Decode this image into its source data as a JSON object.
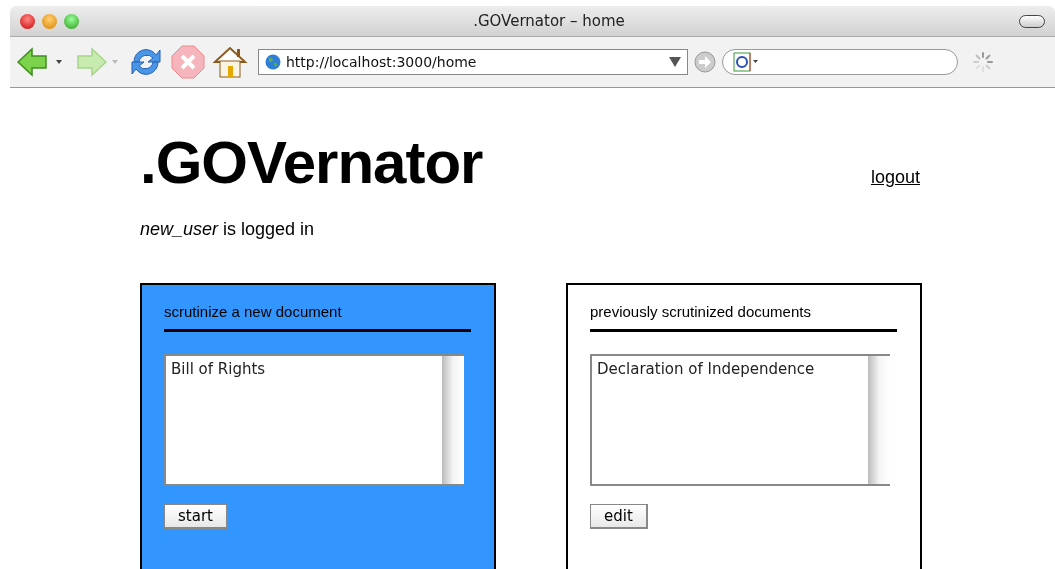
{
  "window": {
    "title": ".GOVernator – home"
  },
  "toolbar": {
    "url": "http://localhost:3000/home"
  },
  "page": {
    "heading": ".GOVernator",
    "logout": "logout",
    "status": "*new_user* is logged in"
  },
  "panels": [
    {
      "title": "scrutinize a new document",
      "color": "#3396ff",
      "items": [
        "Bill of Rights"
      ],
      "button": "start"
    },
    {
      "title": "previously scrutinized documents",
      "color": "#ffffff",
      "items": [
        "Declaration of Independence"
      ],
      "button": "edit"
    }
  ]
}
